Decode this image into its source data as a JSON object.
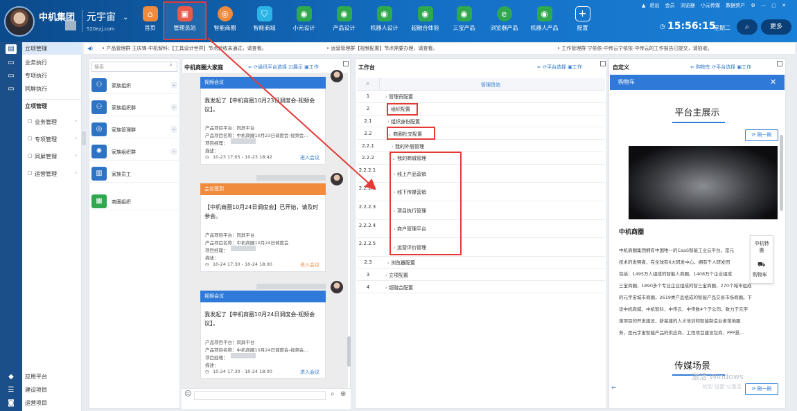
{
  "header": {
    "brand": "中机集团",
    "universe": "元宇宙",
    "universe_url": "520ezj.com",
    "nav": [
      {
        "label": "首页",
        "icon": "home-icon",
        "color": "#f08a3c"
      },
      {
        "label": "管理员站",
        "icon": "admin-station-icon",
        "color": "#e85a4a"
      },
      {
        "label": "智能商圈",
        "icon": "smart-business-icon",
        "color": "#f08a3c"
      },
      {
        "label": "智能商城",
        "icon": "smart-mall-icon",
        "color": "#2bb5e6"
      },
      {
        "label": "小元设计",
        "icon": "globe-icon",
        "color": "#2fa84f"
      },
      {
        "label": "产品设计",
        "icon": "globe-icon",
        "color": "#2fa84f"
      },
      {
        "label": "机器人设计",
        "icon": "globe-icon",
        "color": "#2fa84f"
      },
      {
        "label": "超融合体验",
        "icon": "globe-icon",
        "color": "#2fa84f"
      },
      {
        "label": "三宝产品",
        "icon": "globe-icon",
        "color": "#2fa84f"
      },
      {
        "label": "浏览器产品",
        "icon": "browser-icon",
        "color": "#2fa84f"
      },
      {
        "label": "机器人产品",
        "icon": "globe-icon",
        "color": "#2fa84f"
      },
      {
        "label": "配置",
        "icon": "plus-icon",
        "color": "transparent"
      }
    ],
    "top_links": [
      "退出",
      "会员",
      "浏览器",
      "小元传媒",
      "数据资产"
    ],
    "clock": "15:56:15",
    "weekday": "星期二",
    "more": "更多"
  },
  "sidebar": {
    "top": [
      {
        "label": "立项管理",
        "icon": "briefcase-icon"
      },
      {
        "label": "业务执行",
        "icon": "monitor-icon"
      },
      {
        "label": "专项执行",
        "icon": "screen-icon"
      },
      {
        "label": "同屏执行",
        "icon": "display-icon"
      }
    ],
    "section_title": "立项管理",
    "menu": [
      "业务管理",
      "专项管理",
      "同屏管理",
      "运营管理"
    ],
    "bottom": [
      {
        "label": "应用平台",
        "icon": "cube-icon"
      },
      {
        "label": "建设项目",
        "icon": "list-icon"
      },
      {
        "label": "运营项目",
        "icon": "camera-icon"
      }
    ]
  },
  "ticker": [
    "• 产品管理群  王庆锋-中机智科:【工具设计世界】节点验收未通过，请查看。",
    "• 运营管理群【视频配置】节点需要办理，请查看。",
    "• 工作管理群  宁依依-中传云宁依依-中传云的工作报告已提交，请拍收。"
  ],
  "family": {
    "search_placeholder": "搜索",
    "groups": [
      "家族组织",
      "家族组织群",
      "家族管理群",
      "家族组织群",
      "家族员工",
      "商圈组织"
    ]
  },
  "chat": {
    "title": "中机商圈大家庭",
    "actions": [
      "通讯平台选择",
      "展示",
      "工作"
    ],
    "cards": [
      {
        "type": "视频会议",
        "text": "我发起了【中机商圈10月23日调度会-视频会议】。",
        "platform": "产品项目平台：同屏平台",
        "name": "产品项目名称：中机商圈10月23日调度会-视频会...",
        "manager": "项目经理：",
        "desc": "描述：",
        "time": "10-23 17:05 - 10-23 18:42",
        "enter": "进入会议"
      },
      {
        "type": "会议签到",
        "text": "【中机商圈10月24日调度会】已开始，请及时参会。",
        "platform": "产品项目平台：同屏平台",
        "name": "产品项目名称：中机商圈10月24日调度会",
        "manager": "项目经理：",
        "desc": "描述：",
        "time": "10-24 17:30 - 10-24 18:00",
        "enter": "进入会议"
      },
      {
        "type": "视频会议",
        "text": "我发起了【中机商圈10月24日调度会-视频会议】。",
        "platform": "产品项目平台：同屏平台",
        "name": "产品项目名称：中机商圈10月24日调度会-视频会...",
        "manager": "项目经理：",
        "desc": "描述：",
        "time": "10-24 17:30 - 10-24 18:00",
        "enter": "进入会议"
      }
    ]
  },
  "worktable": {
    "title": "工作台",
    "actions": [
      "平台选择",
      "工作"
    ],
    "column_header": "管理员站",
    "rows": [
      {
        "num": "1",
        "label": "管理员配置",
        "level": 0,
        "expanded": false
      },
      {
        "num": "2",
        "label": "组织配置",
        "level": 0,
        "expanded": true
      },
      {
        "num": "2.1",
        "label": "组织身份配置",
        "level": 1,
        "expanded": false
      },
      {
        "num": "2.2",
        "label": "商圈社交配置",
        "level": 1,
        "expanded": true
      },
      {
        "num": "2.2.1",
        "label": "我的外层管理",
        "level": 2,
        "expanded": false
      },
      {
        "num": "2.2.2",
        "label": "我的商城管理",
        "level": 2,
        "expanded": true
      },
      {
        "num": "2.2.2.1",
        "label": "线上产品营销",
        "level": 3,
        "expanded": false
      },
      {
        "num": "2.2.2.2",
        "label": "线下传媒营销",
        "level": 3,
        "expanded": false
      },
      {
        "num": "2.2.2.3",
        "label": "项目执行管理",
        "level": 3,
        "expanded": false
      },
      {
        "num": "2.2.2.4",
        "label": "商户管理平台",
        "level": 3,
        "expanded": false
      },
      {
        "num": "2.2.2.5",
        "label": "运营评价管理",
        "level": 3,
        "expanded": false
      },
      {
        "num": "2.3",
        "label": "浏览器配置",
        "level": 1,
        "expanded": false
      },
      {
        "num": "3",
        "label": "立项配置",
        "level": 0,
        "expanded": false
      },
      {
        "num": "4",
        "label": "超融合配置",
        "level": 0,
        "expanded": false
      }
    ]
  },
  "custom": {
    "title": "自定义",
    "actions": [
      "购物车",
      "平台选择",
      "工作"
    ],
    "cart_title": "购物车",
    "platform_title": "平台主展示",
    "refresh": "刷一刷",
    "section_title": "中机商圈",
    "desc_lines": [
      "中机商圈集团拥有中国唯一的CaaS智能工业云平台，是元",
      "技术的发明者，在全球有6大研发中心，拥有千人研发团",
      "包括：1495万人组成的智能人商圈，1408万个企业组成",
      "三宝商圈，1890多个专业企业组成的智三宝商圈，270个城市组成",
      "的元宇宙城市商圈，2619类产品组成的智能产品交易市场商圈。下",
      "设中机商城、中机智科、中传云、中传数4个子公司，致力于元宇",
      "宙项目的开发建设，新基建的人才培训和智能制造业者落地服",
      "务，是元宇宙智能产品的供应商，工程项目建设包商，PPP投..."
    ],
    "media_title": "传媒场景",
    "float_items": [
      "中机特惠",
      "购物车"
    ],
    "watermark": "激活 Windows",
    "watermark_sub": "转到\"设置\"以激活"
  }
}
